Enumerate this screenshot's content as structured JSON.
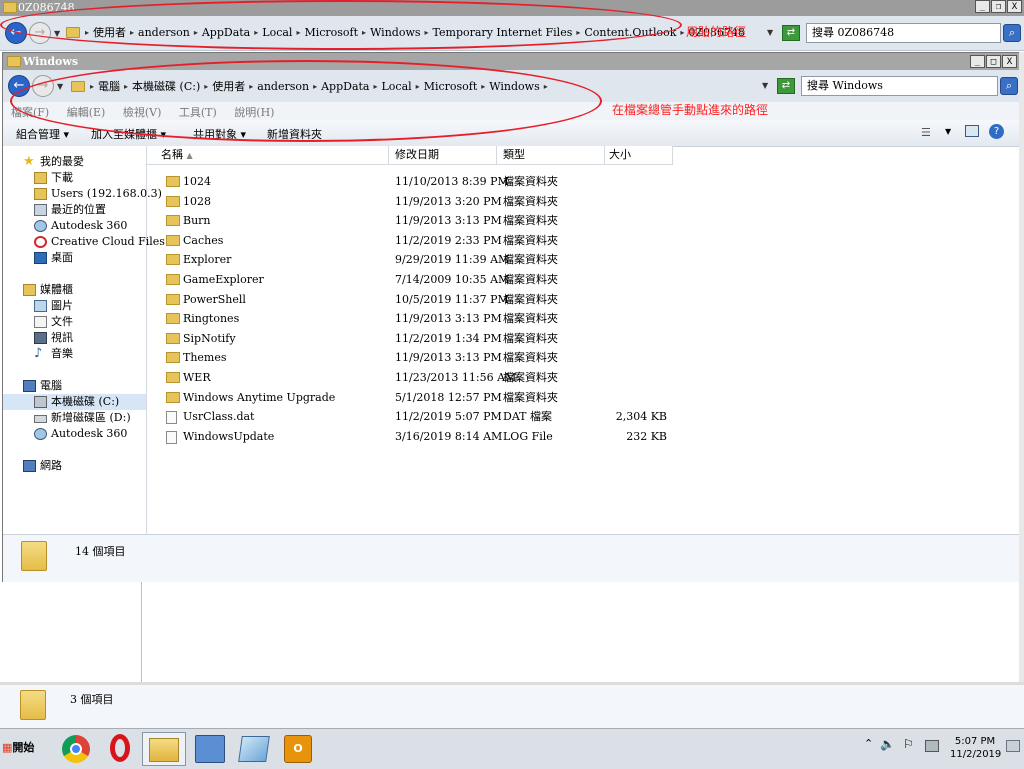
{
  "outer_window": {
    "title": "0Z086748",
    "controls": [
      "_",
      "❐",
      "X"
    ],
    "path": [
      "使用者",
      "anderson",
      "AppData",
      "Local",
      "Microsoft",
      "Windows",
      "Temporary Internet Files",
      "Content.Outlook",
      "0Z086748"
    ],
    "search_text": "搜尋 0Z086748",
    "annotation": "用貼的路徑",
    "status_text": "3 個項目"
  },
  "window": {
    "title": "Windows",
    "controls": [
      "_",
      "□",
      "X"
    ],
    "path": [
      "電腦",
      "本機磁碟 (C:)",
      "使用者",
      "anderson",
      "AppData",
      "Local",
      "Microsoft",
      "Windows"
    ],
    "search_text": "搜尋 Windows",
    "annotation": "在檔案總管手動點進來的路徑",
    "menu": [
      "檔案(F)",
      "編輯(E)",
      "檢視(V)",
      "工具(T)",
      "說明(H)"
    ],
    "commands": {
      "organize": "組合管理",
      "add_to_library": "加入至媒體櫃",
      "share_with": "共用對象",
      "new_folder": "新增資料夾"
    },
    "columns": {
      "name": "名稱",
      "date": "修改日期",
      "type": "類型",
      "size": "大小"
    },
    "status_text": "14 個項目"
  },
  "nav": {
    "favorites_header": "我的最愛",
    "favorites": [
      "下載",
      "Users (192.168.0.3)",
      "最近的位置",
      "Autodesk 360",
      "Creative Cloud Files",
      "桌面"
    ],
    "libraries_header": "媒體櫃",
    "libraries": [
      "圖片",
      "文件",
      "視訊",
      "音樂"
    ],
    "computer_header": "電腦",
    "computer": [
      "本機磁碟 (C:)",
      "新增磁碟區 (D:)",
      "Autodesk 360"
    ],
    "network": "網路"
  },
  "files": [
    {
      "name": "1024",
      "date": "11/10/2013 8:39 PM",
      "type": "檔案資料夾",
      "size": ""
    },
    {
      "name": "1028",
      "date": "11/9/2013 3:20 PM",
      "type": "檔案資料夾",
      "size": ""
    },
    {
      "name": "Burn",
      "date": "11/9/2013 3:13 PM",
      "type": "檔案資料夾",
      "size": ""
    },
    {
      "name": "Caches",
      "date": "11/2/2019 2:33 PM",
      "type": "檔案資料夾",
      "size": ""
    },
    {
      "name": "Explorer",
      "date": "9/29/2019 11:39 AM",
      "type": "檔案資料夾",
      "size": ""
    },
    {
      "name": "GameExplorer",
      "date": "7/14/2009 10:35 AM",
      "type": "檔案資料夾",
      "size": ""
    },
    {
      "name": "PowerShell",
      "date": "10/5/2019 11:37 PM",
      "type": "檔案資料夾",
      "size": ""
    },
    {
      "name": "Ringtones",
      "date": "11/9/2013 3:13 PM",
      "type": "檔案資料夾",
      "size": ""
    },
    {
      "name": "SipNotify",
      "date": "11/2/2019 1:34 PM",
      "type": "檔案資料夾",
      "size": ""
    },
    {
      "name": "Themes",
      "date": "11/9/2013 3:13 PM",
      "type": "檔案資料夾",
      "size": ""
    },
    {
      "name": "WER",
      "date": "11/23/2013 11:56 AM",
      "type": "檔案資料夾",
      "size": ""
    },
    {
      "name": "Windows Anytime Upgrade",
      "date": "5/1/2018 12:57 PM",
      "type": "檔案資料夾",
      "size": ""
    },
    {
      "name": "UsrClass.dat",
      "date": "11/2/2019 5:07 PM",
      "type": "DAT 檔案",
      "size": "2,304 KB"
    },
    {
      "name": "WindowsUpdate",
      "date": "3/16/2019 8:14 AM",
      "type": "LOG File",
      "size": "232 KB"
    }
  ],
  "taskbar": {
    "start_label": "開始",
    "time": "5:07 PM",
    "date": "11/2/2019"
  },
  "colors": {
    "annotation": "#e51f2a",
    "titlebar": "#a6a6a6",
    "toolbar": "#dfe6ee",
    "back_button": "#2a64c8"
  }
}
